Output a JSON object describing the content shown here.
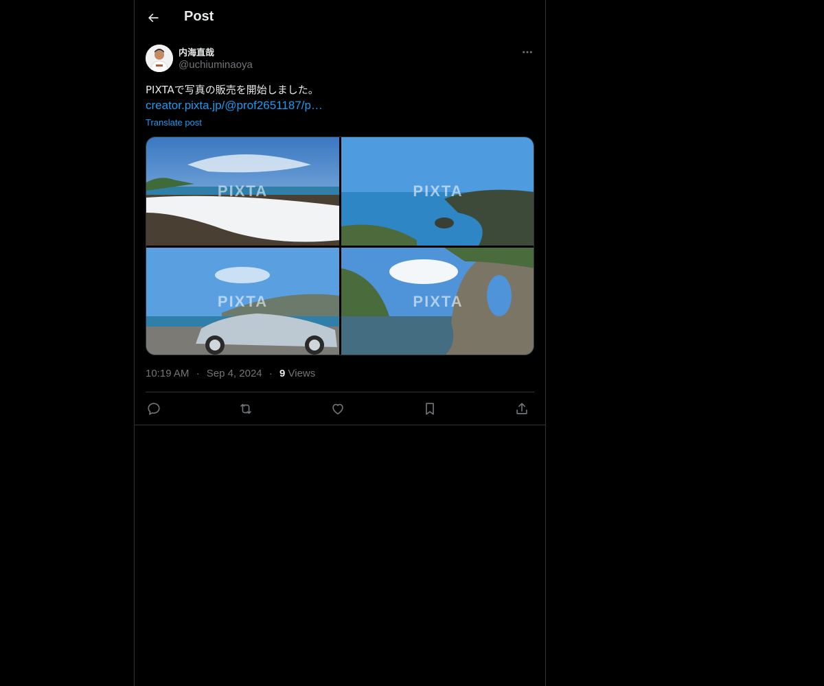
{
  "header": {
    "title": "Post"
  },
  "author": {
    "display_name": "内海直哉",
    "handle": "@uchiuminaoya"
  },
  "post": {
    "text": "PIXTAで写真の販売を開始しました。",
    "link": "creator.pixta.jp/@prof2651187/p…",
    "translate_label": "Translate post",
    "images": [
      {
        "watermark": "PIXTA"
      },
      {
        "watermark": "PIXTA"
      },
      {
        "watermark": "PIXTA"
      },
      {
        "watermark": "PIXTA"
      }
    ]
  },
  "meta": {
    "time": "10:19 AM",
    "date": "Sep 4, 2024",
    "separator": "·",
    "views_count": "9",
    "views_label": "Views"
  },
  "icons": {
    "back": "arrow-left-icon",
    "more": "more-horizontal-icon",
    "reply": "reply-icon",
    "repost": "repost-icon",
    "like": "heart-icon",
    "bookmark": "bookmark-icon",
    "share": "share-icon"
  },
  "colors": {
    "background": "#000000",
    "text": "#e7e9ea",
    "muted": "#71767b",
    "accent": "#1d9bf0",
    "border": "#2f3336"
  }
}
